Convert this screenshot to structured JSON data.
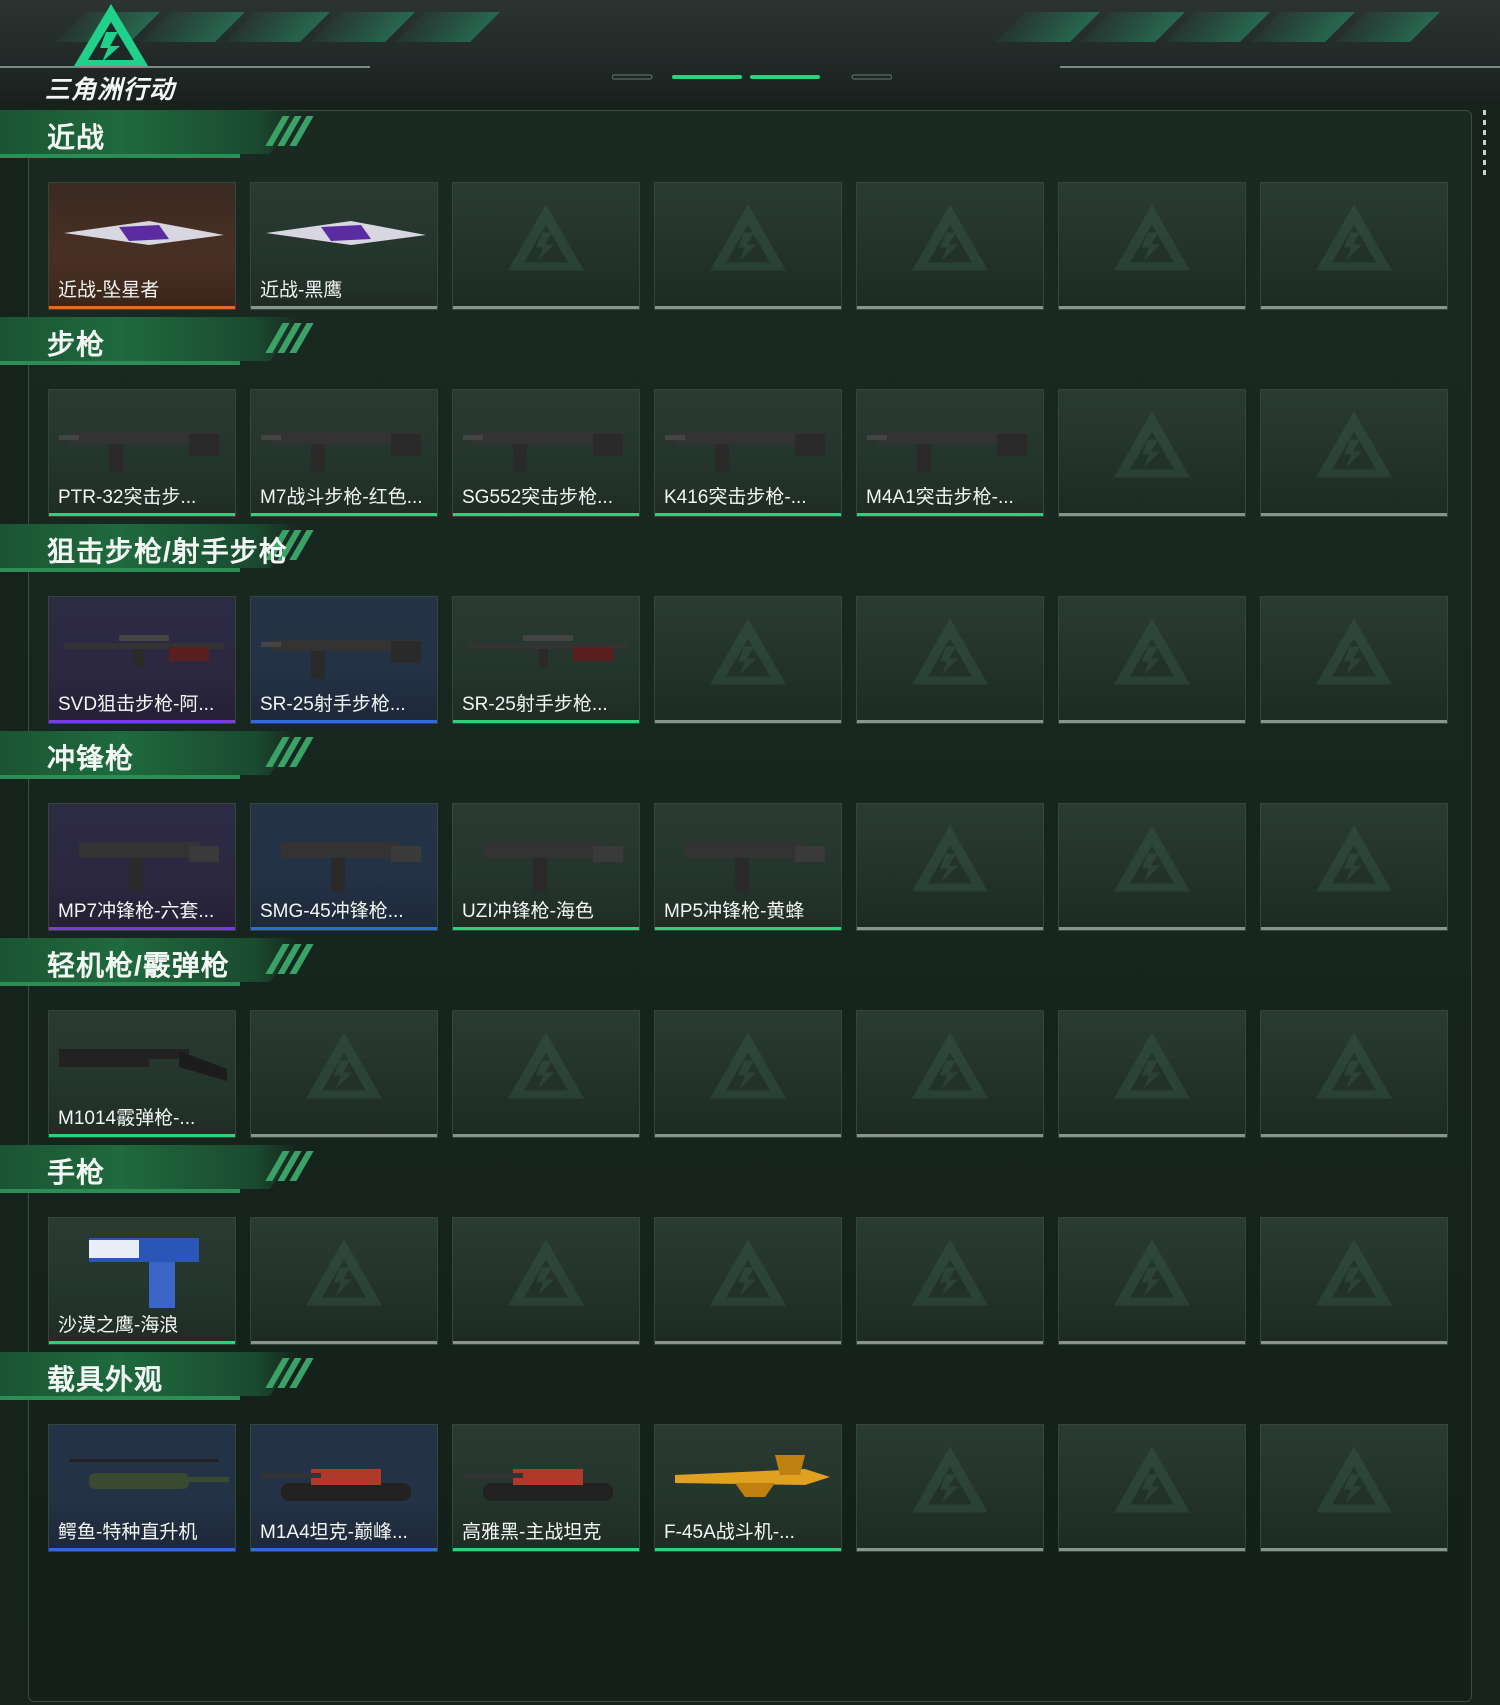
{
  "app": {
    "logo_text": "三角洲行动"
  },
  "colors": {
    "accent_green": "#2cd37a",
    "rarity_orange": "#e06a28",
    "rarity_purple": "#7a3ce0",
    "rarity_blue": "#2f6ad8",
    "rarity_green": "#2cd37a",
    "empty_line": "#8a948f"
  },
  "sections": [
    {
      "title": "近战",
      "items": [
        {
          "label": "近战-坠星者",
          "rarity": "orange",
          "icon": "knife-icon"
        },
        {
          "label": "近战-黑鹰",
          "rarity": "none",
          "icon": "knife-icon"
        },
        null,
        null,
        null,
        null,
        null
      ]
    },
    {
      "title": "步枪",
      "items": [
        {
          "label": "PTR-32突击步...",
          "rarity": "green",
          "icon": "rifle-icon"
        },
        {
          "label": "M7战斗步枪-红色...",
          "rarity": "green",
          "icon": "rifle-icon"
        },
        {
          "label": "SG552突击步枪...",
          "rarity": "green",
          "icon": "rifle-icon"
        },
        {
          "label": "K416突击步枪-...",
          "rarity": "green",
          "icon": "rifle-icon"
        },
        {
          "label": "M4A1突击步枪-...",
          "rarity": "green",
          "icon": "rifle-icon"
        },
        null,
        null
      ]
    },
    {
      "title": "狙击步枪/射手步枪",
      "items": [
        {
          "label": "SVD狙击步枪-阿...",
          "rarity": "purple",
          "icon": "sniper-icon"
        },
        {
          "label": "SR-25射手步枪...",
          "rarity": "blue",
          "icon": "rifle-icon"
        },
        {
          "label": "SR-25射手步枪...",
          "rarity": "green",
          "icon": "sniper-icon"
        },
        null,
        null,
        null,
        null
      ]
    },
    {
      "title": "冲锋枪",
      "items": [
        {
          "label": "MP7冲锋枪-六套...",
          "rarity": "purple",
          "icon": "smg-icon"
        },
        {
          "label": "SMG-45冲锋枪...",
          "rarity": "blue",
          "icon": "smg-icon"
        },
        {
          "label": "UZI冲锋枪-海色",
          "rarity": "green",
          "icon": "smg-icon"
        },
        {
          "label": "MP5冲锋枪-黄蜂",
          "rarity": "green",
          "icon": "smg-icon"
        },
        null,
        null,
        null
      ]
    },
    {
      "title": "轻机枪/霰弹枪",
      "items": [
        {
          "label": "M1014霰弹枪-...",
          "rarity": "green",
          "icon": "shotgun-icon"
        },
        null,
        null,
        null,
        null,
        null,
        null
      ]
    },
    {
      "title": "手枪",
      "items": [
        {
          "label": "沙漠之鹰-海浪",
          "rarity": "green",
          "icon": "pistol-icon"
        },
        null,
        null,
        null,
        null,
        null,
        null
      ]
    },
    {
      "title": "载具外观",
      "items": [
        {
          "label": "鳄鱼-特种直升机",
          "rarity": "blue",
          "icon": "helicopter-icon"
        },
        {
          "label": "M1A4坦克-巅峰...",
          "rarity": "blue",
          "icon": "tank-icon"
        },
        {
          "label": "高雅黑-主战坦克",
          "rarity": "green",
          "icon": "tank-icon"
        },
        {
          "label": "F-45A战斗机-...",
          "rarity": "green",
          "icon": "jet-icon"
        },
        null,
        null,
        null
      ]
    }
  ]
}
